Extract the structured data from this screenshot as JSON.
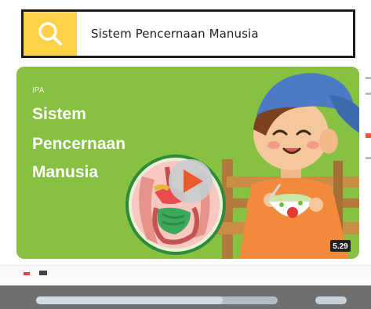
{
  "search": {
    "query": "Sistem Pencernaan Manusia",
    "icon": "search-icon"
  },
  "video": {
    "subject": "IPA",
    "title_lines": [
      "Sistem",
      "Pencernaan",
      "Manusia"
    ],
    "duration": "5.29"
  },
  "colors": {
    "accent": "#ffd24a",
    "thumbnail_bg": "#86c142",
    "bottom_bar": "#6f6f6f"
  }
}
